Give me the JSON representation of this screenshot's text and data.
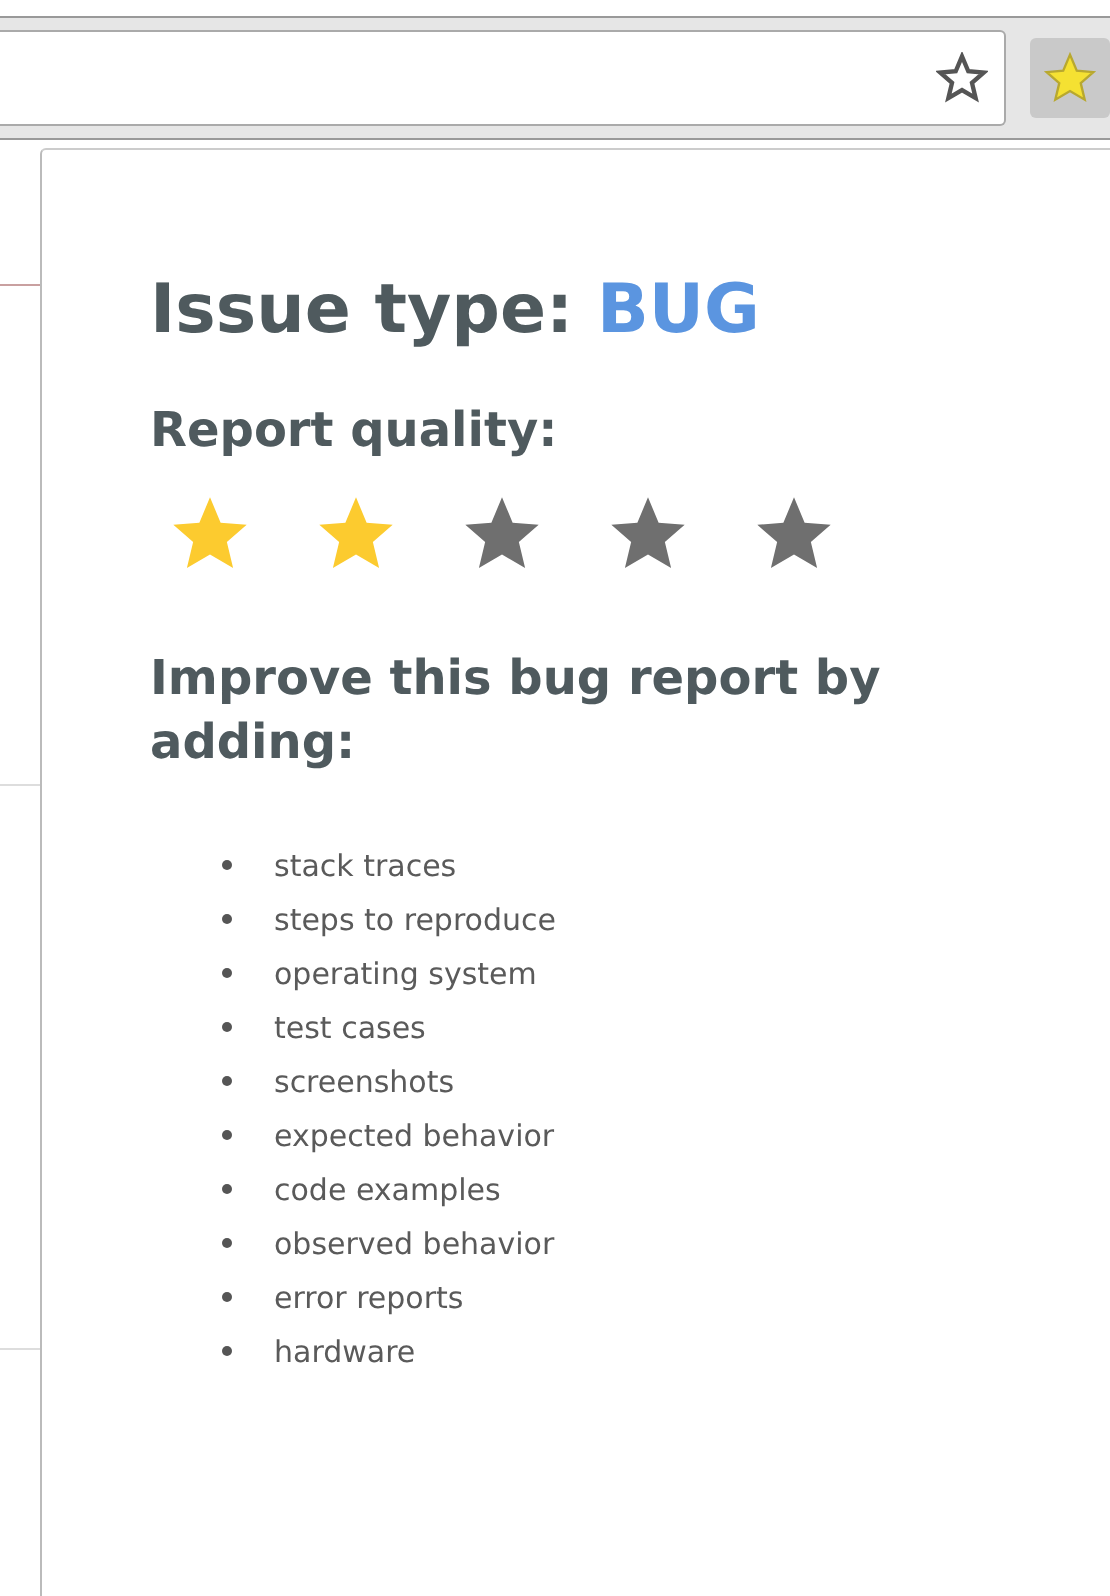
{
  "popup": {
    "title_label": "Issue type:",
    "issue_type": "BUG",
    "quality_label": "Report quality:",
    "rating": {
      "stars": 2
    },
    "improve_heading": "Improve this bug report by adding:",
    "suggestions": [
      "stack traces",
      "steps to reproduce",
      "operating system",
      "test cases",
      "screenshots",
      "expected behavior",
      "code examples",
      "observed behavior",
      "error reports",
      "hardware"
    ]
  }
}
